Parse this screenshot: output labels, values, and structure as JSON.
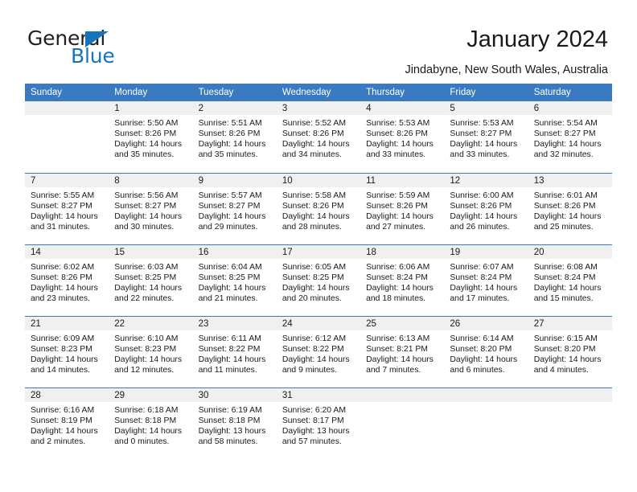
{
  "brand": {
    "name_part1": "General",
    "name_part2": "Blue",
    "triangle_color": "#1574bb"
  },
  "header": {
    "title": "January 2024",
    "subtitle": "Jindabyne, New South Wales, Australia"
  },
  "theme": {
    "header_bg": "#3a7ac0",
    "daynum_bg": "#f0f0f0",
    "text": "#1a1a1a",
    "row_divider": "#3a7ac0"
  },
  "weekday_headers": [
    "Sunday",
    "Monday",
    "Tuesday",
    "Wednesday",
    "Thursday",
    "Friday",
    "Saturday"
  ],
  "labels": {
    "sunrise_prefix": "Sunrise:",
    "sunset_prefix": "Sunset:",
    "daylight_prefix": "Daylight:"
  },
  "weeks": [
    [
      {
        "day": "",
        "sunrise": "",
        "sunset": "",
        "daylight": "",
        "empty": true
      },
      {
        "day": "1",
        "sunrise": "Sunrise: 5:50 AM",
        "sunset": "Sunset: 8:26 PM",
        "daylight": "Daylight: 14 hours and 35 minutes."
      },
      {
        "day": "2",
        "sunrise": "Sunrise: 5:51 AM",
        "sunset": "Sunset: 8:26 PM",
        "daylight": "Daylight: 14 hours and 35 minutes."
      },
      {
        "day": "3",
        "sunrise": "Sunrise: 5:52 AM",
        "sunset": "Sunset: 8:26 PM",
        "daylight": "Daylight: 14 hours and 34 minutes."
      },
      {
        "day": "4",
        "sunrise": "Sunrise: 5:53 AM",
        "sunset": "Sunset: 8:26 PM",
        "daylight": "Daylight: 14 hours and 33 minutes."
      },
      {
        "day": "5",
        "sunrise": "Sunrise: 5:53 AM",
        "sunset": "Sunset: 8:27 PM",
        "daylight": "Daylight: 14 hours and 33 minutes."
      },
      {
        "day": "6",
        "sunrise": "Sunrise: 5:54 AM",
        "sunset": "Sunset: 8:27 PM",
        "daylight": "Daylight: 14 hours and 32 minutes."
      }
    ],
    [
      {
        "day": "7",
        "sunrise": "Sunrise: 5:55 AM",
        "sunset": "Sunset: 8:27 PM",
        "daylight": "Daylight: 14 hours and 31 minutes."
      },
      {
        "day": "8",
        "sunrise": "Sunrise: 5:56 AM",
        "sunset": "Sunset: 8:27 PM",
        "daylight": "Daylight: 14 hours and 30 minutes."
      },
      {
        "day": "9",
        "sunrise": "Sunrise: 5:57 AM",
        "sunset": "Sunset: 8:27 PM",
        "daylight": "Daylight: 14 hours and 29 minutes."
      },
      {
        "day": "10",
        "sunrise": "Sunrise: 5:58 AM",
        "sunset": "Sunset: 8:26 PM",
        "daylight": "Daylight: 14 hours and 28 minutes."
      },
      {
        "day": "11",
        "sunrise": "Sunrise: 5:59 AM",
        "sunset": "Sunset: 8:26 PM",
        "daylight": "Daylight: 14 hours and 27 minutes."
      },
      {
        "day": "12",
        "sunrise": "Sunrise: 6:00 AM",
        "sunset": "Sunset: 8:26 PM",
        "daylight": "Daylight: 14 hours and 26 minutes."
      },
      {
        "day": "13",
        "sunrise": "Sunrise: 6:01 AM",
        "sunset": "Sunset: 8:26 PM",
        "daylight": "Daylight: 14 hours and 25 minutes."
      }
    ],
    [
      {
        "day": "14",
        "sunrise": "Sunrise: 6:02 AM",
        "sunset": "Sunset: 8:26 PM",
        "daylight": "Daylight: 14 hours and 23 minutes."
      },
      {
        "day": "15",
        "sunrise": "Sunrise: 6:03 AM",
        "sunset": "Sunset: 8:25 PM",
        "daylight": "Daylight: 14 hours and 22 minutes."
      },
      {
        "day": "16",
        "sunrise": "Sunrise: 6:04 AM",
        "sunset": "Sunset: 8:25 PM",
        "daylight": "Daylight: 14 hours and 21 minutes."
      },
      {
        "day": "17",
        "sunrise": "Sunrise: 6:05 AM",
        "sunset": "Sunset: 8:25 PM",
        "daylight": "Daylight: 14 hours and 20 minutes."
      },
      {
        "day": "18",
        "sunrise": "Sunrise: 6:06 AM",
        "sunset": "Sunset: 8:24 PM",
        "daylight": "Daylight: 14 hours and 18 minutes."
      },
      {
        "day": "19",
        "sunrise": "Sunrise: 6:07 AM",
        "sunset": "Sunset: 8:24 PM",
        "daylight": "Daylight: 14 hours and 17 minutes."
      },
      {
        "day": "20",
        "sunrise": "Sunrise: 6:08 AM",
        "sunset": "Sunset: 8:24 PM",
        "daylight": "Daylight: 14 hours and 15 minutes."
      }
    ],
    [
      {
        "day": "21",
        "sunrise": "Sunrise: 6:09 AM",
        "sunset": "Sunset: 8:23 PM",
        "daylight": "Daylight: 14 hours and 14 minutes."
      },
      {
        "day": "22",
        "sunrise": "Sunrise: 6:10 AM",
        "sunset": "Sunset: 8:23 PM",
        "daylight": "Daylight: 14 hours and 12 minutes."
      },
      {
        "day": "23",
        "sunrise": "Sunrise: 6:11 AM",
        "sunset": "Sunset: 8:22 PM",
        "daylight": "Daylight: 14 hours and 11 minutes."
      },
      {
        "day": "24",
        "sunrise": "Sunrise: 6:12 AM",
        "sunset": "Sunset: 8:22 PM",
        "daylight": "Daylight: 14 hours and 9 minutes."
      },
      {
        "day": "25",
        "sunrise": "Sunrise: 6:13 AM",
        "sunset": "Sunset: 8:21 PM",
        "daylight": "Daylight: 14 hours and 7 minutes."
      },
      {
        "day": "26",
        "sunrise": "Sunrise: 6:14 AM",
        "sunset": "Sunset: 8:20 PM",
        "daylight": "Daylight: 14 hours and 6 minutes."
      },
      {
        "day": "27",
        "sunrise": "Sunrise: 6:15 AM",
        "sunset": "Sunset: 8:20 PM",
        "daylight": "Daylight: 14 hours and 4 minutes."
      }
    ],
    [
      {
        "day": "28",
        "sunrise": "Sunrise: 6:16 AM",
        "sunset": "Sunset: 8:19 PM",
        "daylight": "Daylight: 14 hours and 2 minutes."
      },
      {
        "day": "29",
        "sunrise": "Sunrise: 6:18 AM",
        "sunset": "Sunset: 8:18 PM",
        "daylight": "Daylight: 14 hours and 0 minutes."
      },
      {
        "day": "30",
        "sunrise": "Sunrise: 6:19 AM",
        "sunset": "Sunset: 8:18 PM",
        "daylight": "Daylight: 13 hours and 58 minutes."
      },
      {
        "day": "31",
        "sunrise": "Sunrise: 6:20 AM",
        "sunset": "Sunset: 8:17 PM",
        "daylight": "Daylight: 13 hours and 57 minutes."
      },
      {
        "day": "",
        "sunrise": "",
        "sunset": "",
        "daylight": "",
        "empty": true
      },
      {
        "day": "",
        "sunrise": "",
        "sunset": "",
        "daylight": "",
        "empty": true
      },
      {
        "day": "",
        "sunrise": "",
        "sunset": "",
        "daylight": "",
        "empty": true
      }
    ]
  ]
}
